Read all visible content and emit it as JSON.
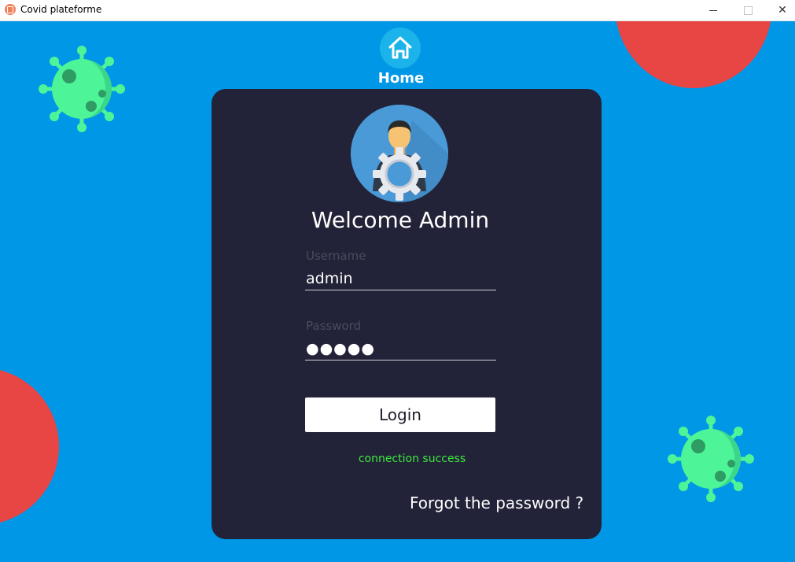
{
  "window": {
    "title": "Covid plateforme",
    "controls": {
      "minimize_icon": "minimize-icon",
      "maximize_icon": "maximize-icon",
      "close_glyph": "✕"
    }
  },
  "colors": {
    "background": "#0097e6",
    "card": "#222338",
    "blob": "#e84545",
    "virus": "#4ef598",
    "status_success": "#3ee83e",
    "home_button": "#1bb3ea"
  },
  "home": {
    "label": "Home",
    "icon": "home-icon"
  },
  "login": {
    "avatar_icon": "admin-avatar-icon",
    "welcome": "Welcome Admin",
    "username": {
      "label": "Username",
      "value": "admin"
    },
    "password": {
      "label": "Password",
      "value": "●●●●●"
    },
    "button_label": "Login",
    "status": "connection success",
    "forgot_link": "Forgot the password ?"
  }
}
